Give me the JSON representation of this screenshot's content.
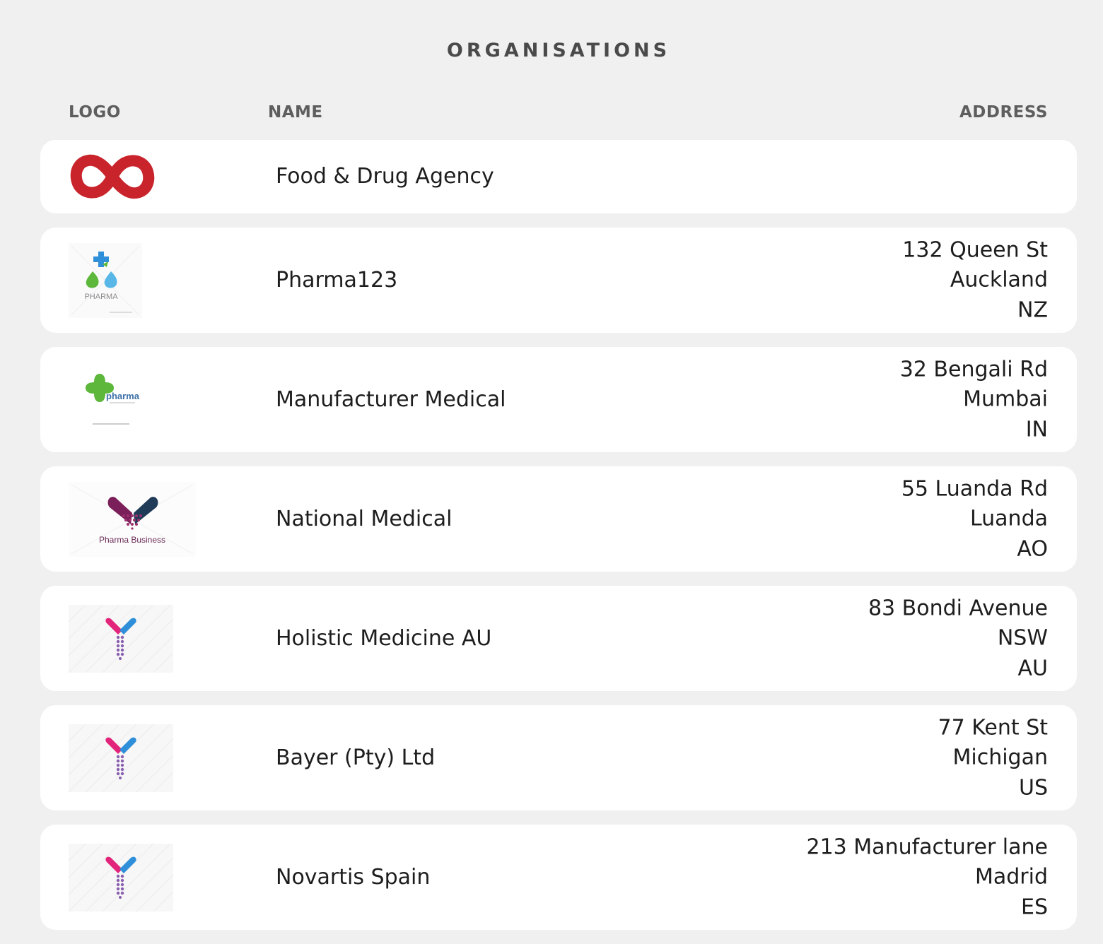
{
  "page": {
    "title": "ORGANISATIONS"
  },
  "table": {
    "headers": {
      "logo": "LOGO",
      "name": "NAME",
      "address": "ADDRESS"
    },
    "rows": [
      {
        "logo_icon": "red-infinity-logo-icon",
        "name": "Food & Drug Agency",
        "address": [
          "",
          "",
          ""
        ]
      },
      {
        "logo_icon": "pharma-cross-drops-logo-icon",
        "logo_text": "PHARMA",
        "name": "Pharma123",
        "address": [
          "132 Queen St",
          "Auckland",
          "NZ"
        ]
      },
      {
        "logo_icon": "green-cross-pharma-logo-icon",
        "logo_text": "pharma",
        "name": "Manufacturer Medical",
        "address": [
          "32 Bengali Rd",
          "Mumbai",
          "IN"
        ]
      },
      {
        "logo_icon": "heart-capsule-logo-icon",
        "logo_text": "Pharma Business",
        "name": "National Medical",
        "address": [
          "55 Luanda Rd",
          "Luanda",
          "AO"
        ]
      },
      {
        "logo_icon": "y-capsule-logo-icon",
        "name": "Holistic Medicine AU",
        "address": [
          "83 Bondi Avenue",
          "NSW",
          "AU"
        ]
      },
      {
        "logo_icon": "y-capsule-logo-icon",
        "name": "Bayer (Pty) Ltd",
        "address": [
          "77 Kent St",
          "Michigan",
          "US"
        ]
      },
      {
        "logo_icon": "y-capsule-logo-icon",
        "name": "Novartis Spain",
        "address": [
          "213 Manufacturer lane",
          "Madrid",
          "ES"
        ]
      }
    ]
  },
  "colors": {
    "background": "#f0f0f0",
    "row": "#ffffff",
    "header_text": "#5e5e5e",
    "title_text": "#4a4a4a",
    "body_text": "#1d1d1d",
    "logo_red": "#c9242c",
    "logo_green": "#5cb73b",
    "logo_blue": "#2f8fd8",
    "logo_magenta": "#e2247a",
    "logo_plum": "#7a1f5a",
    "logo_navy": "#1f3b57"
  }
}
